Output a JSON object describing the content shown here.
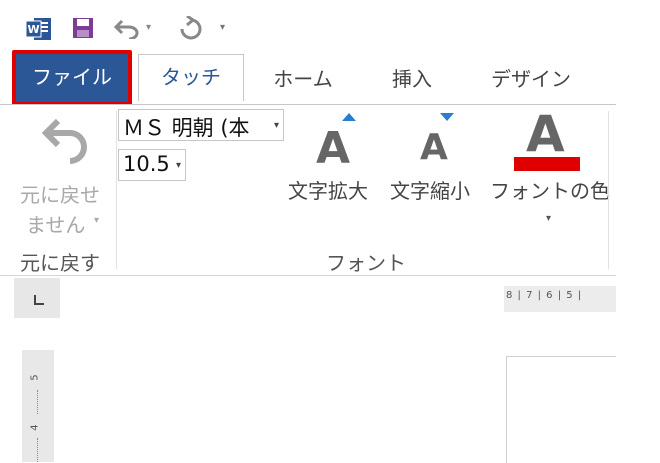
{
  "quick_access": {
    "app_icon": "word-icon",
    "save_icon": "save-icon",
    "undo_icon": "undo-icon",
    "redo_icon": "redo-icon",
    "dropdown_arrow": "▾",
    "customize_arrow": "▾"
  },
  "tabs": {
    "file": "ファイル",
    "touch": "タッチ",
    "home": "ホーム",
    "insert": "挿入",
    "design": "デザイン"
  },
  "ribbon": {
    "undo_group": {
      "button_line1": "元に戻せ",
      "button_line2": "ません",
      "group_label": "元に戻す"
    },
    "font_group": {
      "font_name": "ＭＳ 明朝 (本",
      "font_size": "10.5",
      "grow_label": "文字拡大",
      "shrink_label": "文字縮小",
      "color_label": "フォントの色",
      "font_color": "#e00000",
      "group_label": "フォント"
    }
  },
  "ruler": {
    "horizontal_ticks": "8 | 7 | 6 | 5 |",
    "vertical_5": "5",
    "vertical_4": "4"
  },
  "colors": {
    "file_tab": "#2b5797",
    "highlight_border": "#e00000",
    "accent": "#2b7cd3"
  }
}
